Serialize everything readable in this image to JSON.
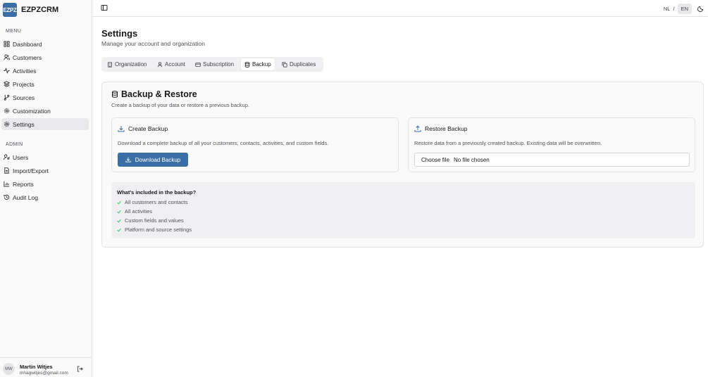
{
  "brand": {
    "logo_text": "EZPZ",
    "name": "EZPZCRM",
    "accent_color": "#3b6ea5"
  },
  "sidebar": {
    "menu_label": "MENU",
    "menu_items": [
      {
        "label": "Dashboard",
        "icon": "dashboard-icon"
      },
      {
        "label": "Customers",
        "icon": "users-icon"
      },
      {
        "label": "Activities",
        "icon": "activity-icon"
      },
      {
        "label": "Projects",
        "icon": "layers-icon"
      },
      {
        "label": "Sources",
        "icon": "git-branch-icon"
      },
      {
        "label": "Customization",
        "icon": "gear-icon"
      },
      {
        "label": "Settings",
        "icon": "gear-icon",
        "active": true
      }
    ],
    "admin_label": "ADMIN",
    "admin_items": [
      {
        "label": "Users",
        "icon": "user-key-icon"
      },
      {
        "label": "Import/Export",
        "icon": "file-icon"
      },
      {
        "label": "Reports",
        "icon": "chart-icon"
      },
      {
        "label": "Audit Log",
        "icon": "history-icon"
      }
    ]
  },
  "user": {
    "initials": "MW",
    "name": "Martin Witjes",
    "email": "mhagwitjes@gmail.com"
  },
  "topbar": {
    "lang_nl": "NL",
    "lang_sep": "/",
    "lang_en": "EN"
  },
  "page": {
    "title": "Settings",
    "subtitle": "Manage your account and organization"
  },
  "tabs": [
    {
      "label": "Organization",
      "icon": "building-icon"
    },
    {
      "label": "Account",
      "icon": "user-icon"
    },
    {
      "label": "Subscription",
      "icon": "credit-card-icon"
    },
    {
      "label": "Backup",
      "icon": "database-icon",
      "active": true
    },
    {
      "label": "Duplicates",
      "icon": "copy-icon"
    }
  ],
  "backup": {
    "title": "Backup & Restore",
    "subtitle": "Create a backup of your data or restore a previous backup.",
    "create": {
      "title": "Create Backup",
      "description": "Download a complete backup of all your customers, contacts, activities, and custom fields.",
      "button": "Download Backup"
    },
    "restore": {
      "title": "Restore Backup",
      "description": "Restore data from a previously created backup. Existing data will be overwritten.",
      "choose_file": "Choose file",
      "no_file": "No file chosen"
    },
    "included": {
      "title": "What's included in the backup?",
      "items": [
        "All customers and contacts",
        "All activities",
        "Custom fields and values",
        "Platform and source settings"
      ],
      "check_color": "#22c55e"
    }
  }
}
